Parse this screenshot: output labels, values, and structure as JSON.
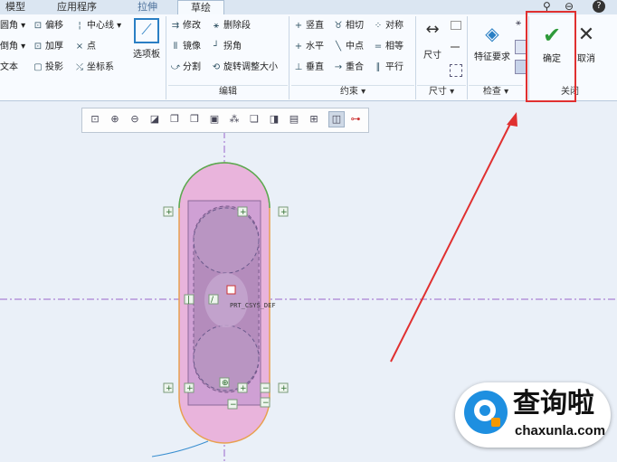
{
  "tabs": [
    "模型",
    "应用程序",
    "拉伸",
    "草绘"
  ],
  "ribbon": {
    "setup": {
      "items": [
        "圆角 ▾",
        "倒角 ▾",
        "文本"
      ]
    },
    "sketch": {
      "items": [
        "偏移",
        "加厚",
        "投影"
      ],
      "items2": [
        "中心线 ▾",
        "点",
        "坐标系"
      ],
      "palette": "选项板"
    },
    "edit": {
      "items": [
        "修改",
        "镜像",
        "分割"
      ],
      "items2": [
        "删除段",
        "拐角",
        "旋转调整大小"
      ],
      "label": "编辑"
    },
    "constraint": {
      "items": [
        "竖直",
        "水平",
        "垂直"
      ],
      "items2": [
        "相切",
        "中点",
        "重合"
      ],
      "items3": [
        "对称",
        "相等",
        "平行"
      ],
      "label": "约束 ▾"
    },
    "dimension": {
      "btn": "尺寸",
      "label": "尺寸 ▾"
    },
    "inspect": {
      "btn": "特征要求",
      "label": "检查 ▾"
    },
    "close": {
      "ok": "确定",
      "cancel": "取消",
      "label": "关闭"
    }
  },
  "canvas": {
    "csys_label": "PRT_CSYS_DEF"
  },
  "watermark": {
    "title": "查询啦",
    "url": "chaxunla.com"
  },
  "colors": {
    "accent_red": "#e03030",
    "ok_green": "#2e9a3a",
    "sketch_pink": "#e9b4dc",
    "sketch_purple": "#b48cbc"
  }
}
